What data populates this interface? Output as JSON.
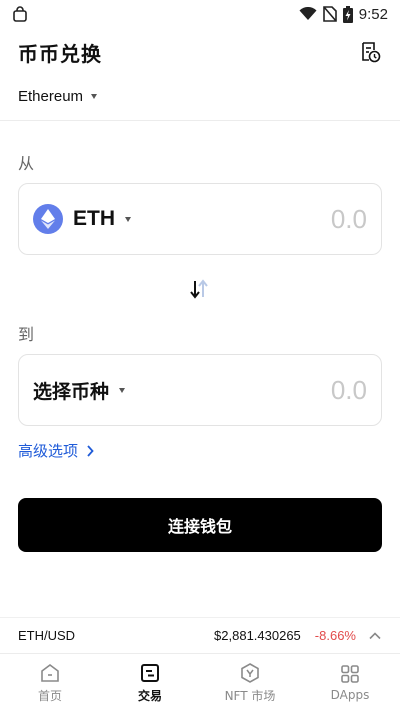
{
  "status_bar": {
    "time": "9:52"
  },
  "header": {
    "title": "币币兑换"
  },
  "network": {
    "name": "Ethereum"
  },
  "from": {
    "label": "从",
    "token": "ETH",
    "amount_placeholder": "0.0"
  },
  "to": {
    "label": "到",
    "token": "选择币种",
    "amount_placeholder": "0.0"
  },
  "advanced": {
    "label": "高级选项"
  },
  "connect_button": {
    "label": "连接钱包"
  },
  "ticker": {
    "pair": "ETH/USD",
    "price": "$2,881.430265",
    "change": "-8.66%"
  },
  "nav": [
    {
      "label": "首页",
      "icon": "home-icon",
      "active": false
    },
    {
      "label": "交易",
      "icon": "trade-icon",
      "active": true
    },
    {
      "label": "NFT 市场",
      "icon": "nft-icon",
      "active": false
    },
    {
      "label": "DApps",
      "icon": "dapps-icon",
      "active": false
    }
  ],
  "colors": {
    "accent_link": "#1f5bd8",
    "primary_button": "#000000",
    "negative": "#e24b4b",
    "eth_brand": "#627eea"
  }
}
